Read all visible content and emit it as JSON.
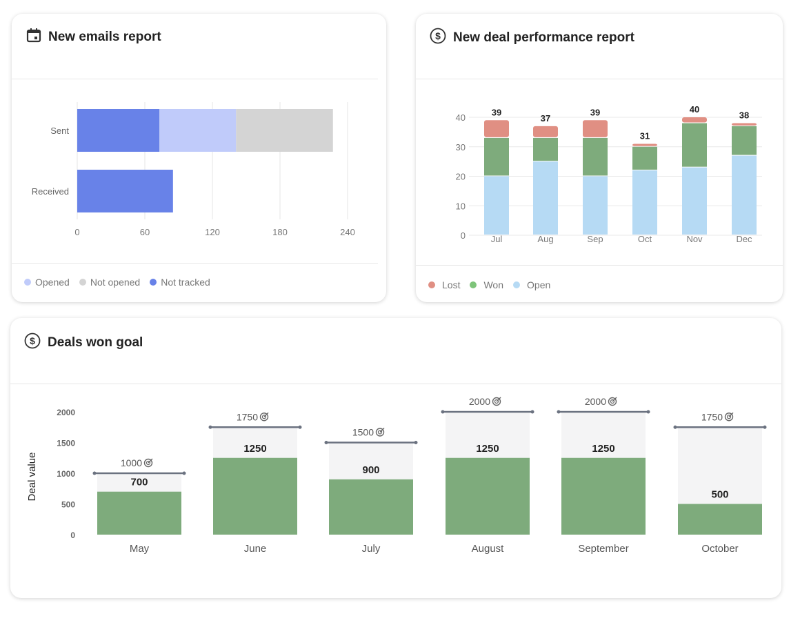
{
  "cards": {
    "emails": {
      "title": "New emails report",
      "icon": "calendar-icon"
    },
    "deals": {
      "title": "New deal performance report",
      "icon": "dollar-circle-icon"
    },
    "goal": {
      "title": "Deals won goal",
      "icon": "dollar-circle-icon"
    }
  },
  "chart_data": [
    {
      "type": "bar",
      "orientation": "horizontal",
      "stacked": true,
      "categories": [
        "Sent",
        "Received"
      ],
      "series": [
        {
          "name": "Not tracked",
          "color": "#6882e8",
          "values": [
            73,
            85
          ]
        },
        {
          "name": "Opened",
          "color": "#c0cbfa",
          "values": [
            68,
            0
          ]
        },
        {
          "name": "Not opened",
          "color": "#d4d4d4",
          "values": [
            86,
            0
          ]
        }
      ],
      "xlim": [
        0,
        240
      ],
      "xticks": [
        "0",
        "60",
        "120",
        "180",
        "240"
      ],
      "legend": [
        "Opened",
        "Not opened",
        "Not tracked"
      ],
      "legend_position": "bottom-left",
      "grid": true
    },
    {
      "type": "bar",
      "stacked": true,
      "categories": [
        "Jul",
        "Aug",
        "Sep",
        "Oct",
        "Nov",
        "Dec"
      ],
      "series": [
        {
          "name": "Open",
          "color": "#b6daf4",
          "values": [
            20,
            25,
            20,
            22,
            23,
            27
          ]
        },
        {
          "name": "Won",
          "color": "#7eab7c",
          "values": [
            13,
            8,
            13,
            8,
            15,
            10
          ]
        },
        {
          "name": "Lost",
          "color": "#e08f83",
          "values": [
            6,
            4,
            6,
            1,
            2,
            1
          ]
        }
      ],
      "totals": [
        "39",
        "37",
        "39",
        "31",
        "40",
        "38"
      ],
      "ylim": [
        0,
        40
      ],
      "yticks": [
        "0",
        "10",
        "20",
        "30",
        "40"
      ],
      "legend": [
        "Lost",
        "Won",
        "Open"
      ],
      "legend_colors": [
        "#e08f83",
        "#7ec47a",
        "#b6daf4"
      ],
      "legend_position": "bottom-left",
      "grid": true
    },
    {
      "type": "bar",
      "categories": [
        "May",
        "June",
        "July",
        "August",
        "September",
        "October"
      ],
      "values": [
        700,
        1250,
        900,
        1250,
        1250,
        500
      ],
      "goals": [
        1000,
        1750,
        1500,
        2000,
        2000,
        1750
      ],
      "ylabel": "Deal value",
      "ylim": [
        0,
        2000
      ],
      "yticks": [
        "0",
        "500",
        "1000",
        "1500",
        "2000"
      ],
      "bar_color": "#7eab7c",
      "goal_fill": "#f4f4f5",
      "goal_line_color": "#6b7280",
      "goal_icon": "target-icon"
    }
  ]
}
